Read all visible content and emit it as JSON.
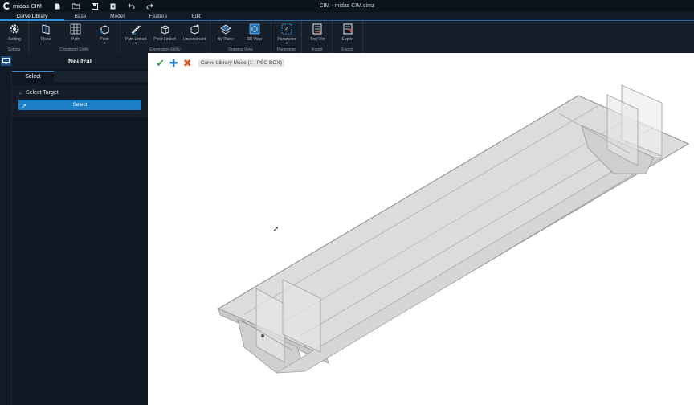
{
  "titlebar": {
    "app_name": "midas CIM",
    "window_title": "CIM - midas CIM.cimz",
    "quick_access": [
      "new-file-icon",
      "open-folder-icon",
      "save-icon",
      "close-file-icon",
      "undo-icon",
      "redo-icon"
    ]
  },
  "menu": {
    "tabs": [
      "Curve Library",
      "Base",
      "Model",
      "Feature",
      "Edit"
    ],
    "active": "Curve Library"
  },
  "ribbon": {
    "groups": {
      "setting": "Setting",
      "constraint": "Constraint Entity",
      "expression": "Expression Entity",
      "drawing": "Drawing View",
      "parameter": "Parameter",
      "import": "Import",
      "export": "Export"
    },
    "buttons": {
      "setting": "Setting",
      "plane": "Plane",
      "path": "Path",
      "point": "Point",
      "path_linked": "Path Linked",
      "point_linked": "Point Linked",
      "unconstraint": "Unconstraint",
      "by_plane": "By Plane",
      "view_3d": "3D View",
      "parameter": "Parameter",
      "text_file": "Text File",
      "export": "Export"
    }
  },
  "panel": {
    "title": "Neutral",
    "tab": "Select",
    "section_title": "Select Target",
    "select_button": "Select"
  },
  "viewport": {
    "mode_label": "Curve Library Mode (1 : PSC BOX)",
    "tools": [
      "check-icon",
      "plus-icon",
      "cancel-icon"
    ],
    "colors": {
      "check": "#3aa44a",
      "plus": "#1f7fc8",
      "cancel": "#d2572b"
    }
  }
}
